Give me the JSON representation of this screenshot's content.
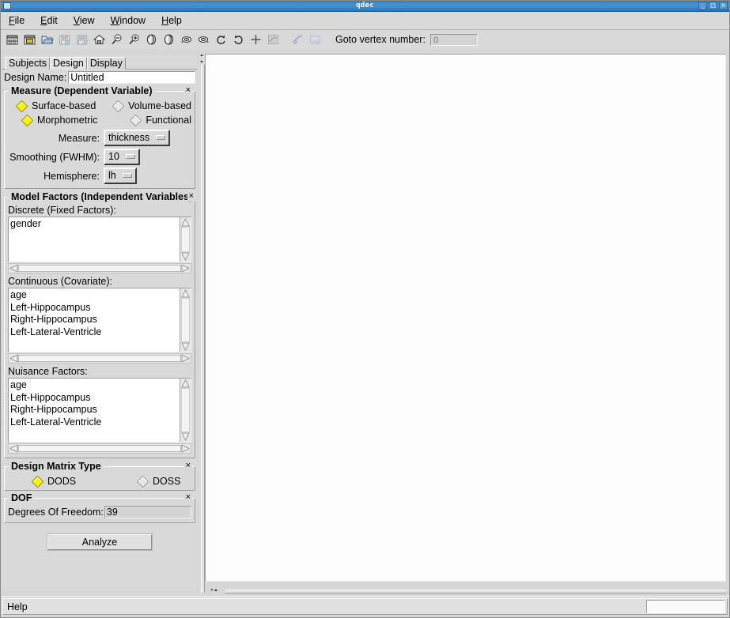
{
  "window": {
    "title": "qdec",
    "buttons": {
      "minimize": "_",
      "maximize": "□",
      "close": "✕"
    }
  },
  "menubar": {
    "items": [
      {
        "label": "File",
        "mnemonic": "F"
      },
      {
        "label": "Edit",
        "mnemonic": "E"
      },
      {
        "label": "View",
        "mnemonic": "V"
      },
      {
        "label": "Window",
        "mnemonic": "W"
      },
      {
        "label": "Help",
        "mnemonic": "H"
      }
    ]
  },
  "toolbar": {
    "icons": [
      {
        "name": "load-data-table-icon",
        "enabled": true
      },
      {
        "name": "load-design-icon",
        "enabled": true
      },
      {
        "name": "open-folder-icon",
        "enabled": true
      },
      {
        "name": "save-data-table-icon",
        "enabled": false
      },
      {
        "name": "save-design-icon",
        "enabled": false
      },
      {
        "name": "restore-view-home-icon",
        "enabled": true
      },
      {
        "name": "zoom-out-icon",
        "enabled": true
      },
      {
        "name": "zoom-in-icon",
        "enabled": true
      },
      {
        "name": "rotate-brain-left-icon",
        "enabled": true
      },
      {
        "name": "rotate-brain-right-icon",
        "enabled": true
      },
      {
        "name": "rotate-brain-up-icon",
        "enabled": true
      },
      {
        "name": "rotate-brain-down-icon",
        "enabled": true
      },
      {
        "name": "rotate-ccw-icon",
        "enabled": true
      },
      {
        "name": "rotate-cw-icon",
        "enabled": true
      },
      {
        "name": "show-cursor-icon",
        "enabled": true
      },
      {
        "name": "show-curvature-icon",
        "enabled": false
      },
      {
        "name": "save-point-set-icon",
        "enabled": false
      },
      {
        "name": "save-screenshot-icon",
        "enabled": false
      }
    ],
    "goto_vertex_label": "Goto vertex number:",
    "goto_vertex_value": "0"
  },
  "tabs": [
    {
      "id": "subjects",
      "label": "Subjects",
      "active": false
    },
    {
      "id": "design",
      "label": "Design",
      "active": true
    },
    {
      "id": "display",
      "label": "Display",
      "active": false
    }
  ],
  "design": {
    "design_name_label": "Design Name:",
    "design_name_value": "Untitled",
    "measure_group": {
      "title": "Measure (Dependent Variable)",
      "close": "×",
      "radios_row1": [
        {
          "label": "Surface-based",
          "selected": true
        },
        {
          "label": "Volume-based",
          "selected": false
        }
      ],
      "radios_row2": [
        {
          "label": "Morphometric",
          "selected": true
        },
        {
          "label": "Functional",
          "selected": false
        }
      ],
      "measure_label": "Measure:",
      "measure_value": "thickness",
      "smoothing_label": "Smoothing (FWHM):",
      "smoothing_value": "10",
      "hemisphere_label": "Hemisphere:",
      "hemisphere_value": "lh"
    },
    "factors_group": {
      "title": "Model Factors (Independent Variables)",
      "close": "×",
      "discrete_label": "Discrete (Fixed Factors):",
      "discrete_items": [
        "gender"
      ],
      "continuous_label": "Continuous (Covariate):",
      "continuous_items": [
        "age",
        "Left-Hippocampus",
        "Right-Hippocampus",
        "Left-Lateral-Ventricle"
      ],
      "nuisance_label": "Nuisance Factors:",
      "nuisance_items": [
        "age",
        "Left-Hippocampus",
        "Right-Hippocampus",
        "Left-Lateral-Ventricle"
      ]
    },
    "matrix_group": {
      "title": "Design Matrix Type",
      "close": "×",
      "options": [
        {
          "label": "DODS",
          "selected": true
        },
        {
          "label": "DOSS",
          "selected": false
        }
      ]
    },
    "dof_group": {
      "title": "DOF",
      "close": "×",
      "label": "Degrees Of Freedom:",
      "value": "39"
    },
    "analyze_button": "Analyze"
  },
  "statusbar": {
    "text": "Help"
  },
  "colors": {
    "titlebar": "#3a86c9",
    "radio_selected": "#fcf414",
    "panel_bg": "#d9d9d9",
    "canvas_bg": "#fdfdfd"
  }
}
